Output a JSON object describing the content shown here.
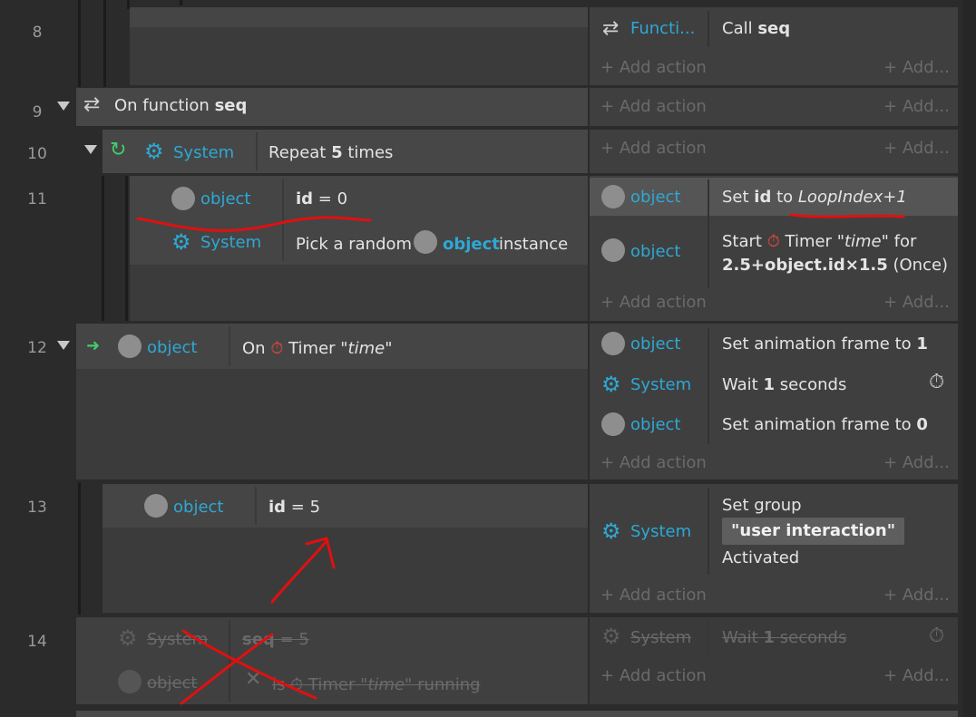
{
  "row_numbers": [
    "8",
    "9",
    "10",
    "11",
    "12",
    "13",
    "14"
  ],
  "common": {
    "add_action": "Add action",
    "add_short": "Add...",
    "system": "System",
    "object": "object"
  },
  "row8": {
    "action_obj": "Functi...",
    "action_prefix": "Call",
    "action_name": "seq"
  },
  "row9": {
    "prefix": "On function",
    "name": "seq"
  },
  "row10": {
    "cond_text_a": "Repeat",
    "cond_count": "5",
    "cond_text_b": "times"
  },
  "row11": {
    "c1_var": "id",
    "c1_eq": "=",
    "c1_val": "0",
    "c2_text_a": "Pick a random",
    "c2_obj": "object",
    "c2_text_b": "instance",
    "a1_prefix": "Set",
    "a1_var": "id",
    "a1_to": "to",
    "a1_expr": "LoopIndex+1",
    "a2_start": "Start",
    "a2_timer": "Timer",
    "a2_name": "\"time\"",
    "a2_for": "for",
    "a2_expr": "2.5+object.id×1.5",
    "a2_once": "(Once)"
  },
  "row12": {
    "on": "On",
    "timer": "Timer",
    "name": "\"time\"",
    "a1": "Set animation frame to",
    "a1_val": "1",
    "a2": "Wait",
    "a2_val": "1",
    "a2_unit": "seconds",
    "a3": "Set animation frame to",
    "a3_val": "0"
  },
  "row13": {
    "c_var": "id",
    "c_eq": "=",
    "c_val": "5",
    "a_set": "Set group",
    "a_group": "\"user interaction\"",
    "a_state": "Activated"
  },
  "row14": {
    "c1_var": "seq",
    "c1_eq": "=",
    "c1_val": "5",
    "c2_is": "is",
    "c2_timer": "Timer",
    "c2_name": "\"time\"",
    "c2_running": "running",
    "a_wait": "Wait",
    "a_val": "1",
    "a_unit": "seconds"
  },
  "colors": {
    "accent": "#2ea8d4",
    "red_timer": "#e0473e",
    "green_loop": "#3ecf6a",
    "annotation": "#e01010"
  }
}
